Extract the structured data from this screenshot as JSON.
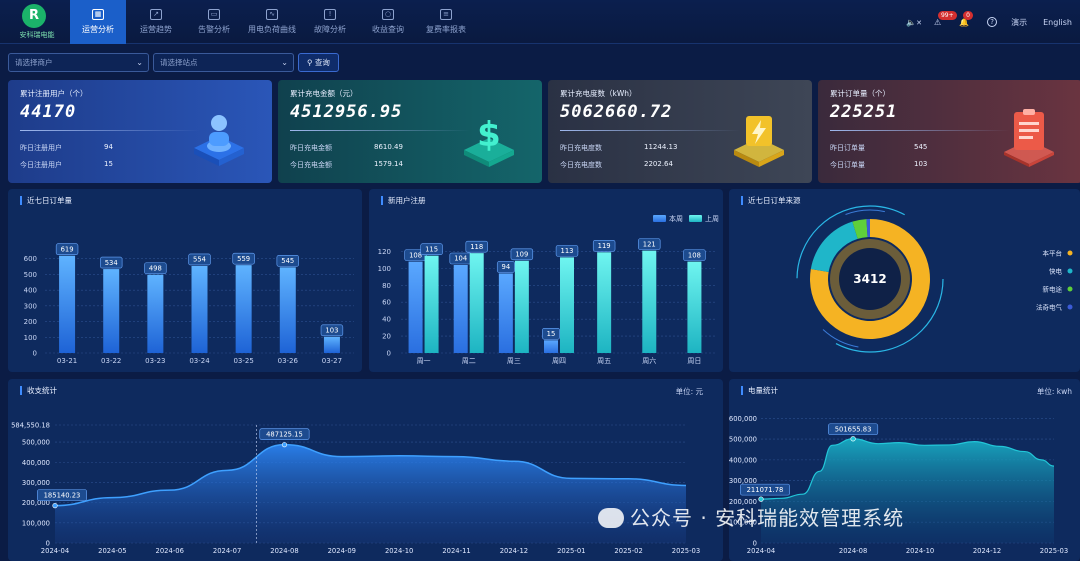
{
  "brand": {
    "name": "安科瑞电能",
    "mark": "R"
  },
  "nav": [
    {
      "label": "运营分析",
      "active": true
    },
    {
      "label": "运营趋势",
      "active": false
    },
    {
      "label": "告警分析",
      "active": false
    },
    {
      "label": "用电负荷曲线",
      "active": false
    },
    {
      "label": "故障分析",
      "active": false
    },
    {
      "label": "收益查询",
      "active": false
    },
    {
      "label": "复费率报表",
      "active": false
    }
  ],
  "topright": {
    "mute": "✕",
    "alarm_badge": "99+",
    "bell_badge": "0",
    "help": "?",
    "demo": "演示",
    "lang": "English"
  },
  "filters": {
    "merchant_placeholder": "请选择商户",
    "station_placeholder": "请选择站点",
    "query": "查询"
  },
  "cards": [
    {
      "title": "累计注册用户（个）",
      "value": "44170",
      "row1_label": "昨日注册用户",
      "row1_value": "94",
      "row2_label": "今日注册用户",
      "row2_value": "15",
      "icon": "user-icon"
    },
    {
      "title": "累计充电金额（元）",
      "value": "4512956.95",
      "row1_label": "昨日充电金额",
      "row1_value": "8610.49",
      "row2_label": "今日充电金额",
      "row2_value": "1579.14",
      "icon": "dollar-icon"
    },
    {
      "title": "累计充电度数（kWh）",
      "value": "5062660.72",
      "row1_label": "昨日充电度数",
      "row1_value": "11244.13",
      "row2_label": "今日充电度数",
      "row2_value": "2202.64",
      "icon": "lightning-icon"
    },
    {
      "title": "累计订单量（个）",
      "value": "225251",
      "row1_label": "昨日订单量",
      "row1_value": "545",
      "row2_label": "今日订单量",
      "row2_value": "103",
      "icon": "clipboard-icon"
    }
  ],
  "panels": {
    "orders7": "近七日订单量",
    "newusers": "新用户注册",
    "sources": "近七日订单来源",
    "revenue": "收支统计",
    "revenue_unit": "单位: 元",
    "energy": "电量统计",
    "energy_unit": "单位: kwh"
  },
  "watermark": "公众号 · 安科瑞能效管理系统",
  "chart_data": [
    {
      "type": "bar",
      "title": "近七日订单量",
      "categories": [
        "03-21",
        "03-22",
        "03-23",
        "03-24",
        "03-25",
        "03-26",
        "03-27"
      ],
      "values": [
        619,
        534,
        498,
        554,
        559,
        545,
        103
      ],
      "ylim": [
        0,
        700
      ],
      "yticks": [
        0,
        100,
        200,
        300,
        400,
        500,
        600
      ],
      "grid": true
    },
    {
      "type": "bar",
      "title": "新用户注册",
      "categories": [
        "周一",
        "周二",
        "周三",
        "周四",
        "周五",
        "周六",
        "周日"
      ],
      "series": [
        {
          "name": "本周",
          "values": [
            108,
            104,
            94,
            15,
            null,
            null,
            null
          ],
          "color": "#4e9bf2"
        },
        {
          "name": "上周",
          "values": [
            115,
            118,
            109,
            113,
            119,
            121,
            108
          ],
          "color": "#4fe3e3"
        }
      ],
      "ylim": [
        0,
        130
      ],
      "yticks": [
        0,
        20,
        40,
        60,
        80,
        100,
        120
      ],
      "legend": "top-right",
      "grid": true
    },
    {
      "type": "pie",
      "title": "近七日订单来源",
      "center_value": "3412",
      "labels": [
        "本平台",
        "快电",
        "新电途",
        "法奇电气"
      ],
      "values": [
        2650,
        600,
        130,
        32
      ],
      "colors": [
        "#f5b323",
        "#1fb6c9",
        "#5fcf3a",
        "#3b5bd6"
      ],
      "legend": "right"
    },
    {
      "type": "area",
      "title": "收支统计",
      "x": [
        "2024-04",
        "2024-05",
        "2024-06",
        "2024-07",
        "2024-08",
        "2024-09",
        "2024-10",
        "2024-11",
        "2024-12",
        "2025-01",
        "2025-02",
        "2025-03"
      ],
      "values": [
        185140.23,
        225000,
        262000,
        360000,
        487125.15,
        428000,
        432000,
        428000,
        405000,
        320000,
        318000,
        285000
      ],
      "yticks": [
        0,
        100000,
        200000,
        300000,
        400000,
        500000
      ],
      "ymax_label": "584,550.18",
      "ylim": [
        0,
        584550.18
      ],
      "annotations": [
        {
          "x": "2024-04",
          "label": "185140.23"
        },
        {
          "x": "2024-08",
          "label": "487125.15"
        }
      ],
      "grid": true
    },
    {
      "type": "area",
      "title": "电量统计",
      "x_ticks": [
        "2024-04",
        "2024-08",
        "2024-10",
        "2024-12",
        "2025-03"
      ],
      "points": [
        [
          0,
          211071.78
        ],
        [
          0.5,
          215000
        ],
        [
          1,
          235000
        ],
        [
          1.4,
          345000
        ],
        [
          1.7,
          470000
        ],
        [
          2.2,
          501655.83
        ],
        [
          2.8,
          478000
        ],
        [
          3.3,
          483000
        ],
        [
          3.9,
          470000
        ],
        [
          4.5,
          472000
        ],
        [
          5.1,
          488000
        ],
        [
          5.7,
          465000
        ],
        [
          6.3,
          440000
        ],
        [
          6.7,
          400000
        ],
        [
          7,
          370000
        ]
      ],
      "x_positions": [
        0,
        2.2,
        3.8,
        5.4,
        7
      ],
      "yticks": [
        0,
        100000,
        200000,
        300000,
        400000,
        500000,
        600000
      ],
      "ylim": [
        0,
        640000
      ],
      "annotations": [
        {
          "x": 0,
          "label": "211071.78"
        },
        {
          "x": 2.2,
          "label": "501655.83"
        }
      ],
      "grid": true
    }
  ]
}
